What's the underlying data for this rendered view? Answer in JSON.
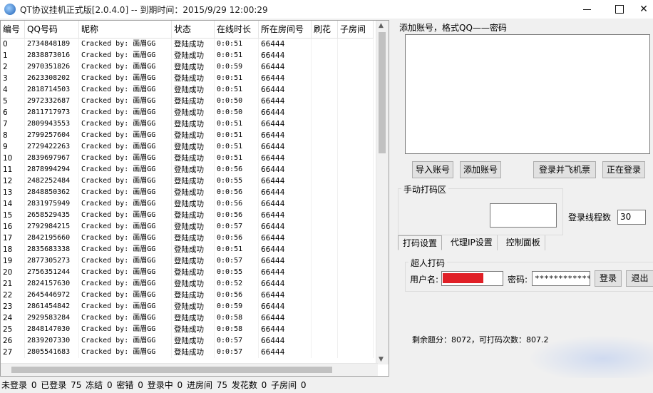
{
  "window": {
    "title": "QT协议挂机正式版[2.0.4.0] -- 到期时间：2015/9/29 12:00:29",
    "icon": "qq-globe-icon",
    "close_glyph": "✕"
  },
  "grid": {
    "columns": [
      "编号",
      "QQ号码",
      "昵称",
      "状态",
      "在线时长",
      "所在房间号",
      "刷花",
      "子房间"
    ],
    "rows": [
      [
        "0",
        "2734848189",
        "Cracked by: 画眉GG",
        "登陆成功",
        "0:0:51",
        "66444"
      ],
      [
        "1",
        "2838873016",
        "Cracked by: 画眉GG",
        "登陆成功",
        "0:0:51",
        "66444"
      ],
      [
        "2",
        "2970351826",
        "Cracked by: 画眉GG",
        "登陆成功",
        "0:0:59",
        "66444"
      ],
      [
        "3",
        "2623308202",
        "Cracked by: 画眉GG",
        "登陆成功",
        "0:0:51",
        "66444"
      ],
      [
        "4",
        "2818714503",
        "Cracked by: 画眉GG",
        "登陆成功",
        "0:0:51",
        "66444"
      ],
      [
        "5",
        "2972332687",
        "Cracked by: 画眉GG",
        "登陆成功",
        "0:0:50",
        "66444"
      ],
      [
        "6",
        "2811717973",
        "Cracked by: 画眉GG",
        "登陆成功",
        "0:0:50",
        "66444"
      ],
      [
        "7",
        "2809943553",
        "Cracked by: 画眉GG",
        "登陆成功",
        "0:0:51",
        "66444"
      ],
      [
        "8",
        "2799257604",
        "Cracked by: 画眉GG",
        "登陆成功",
        "0:0:51",
        "66444"
      ],
      [
        "9",
        "2729422263",
        "Cracked by: 画眉GG",
        "登陆成功",
        "0:0:51",
        "66444"
      ],
      [
        "10",
        "2839697967",
        "Cracked by: 画眉GG",
        "登陆成功",
        "0:0:51",
        "66444"
      ],
      [
        "11",
        "2878994294",
        "Cracked by: 画眉GG",
        "登陆成功",
        "0:0:56",
        "66444"
      ],
      [
        "12",
        "2482252484",
        "Cracked by: 画眉GG",
        "登陆成功",
        "0:0:55",
        "66444"
      ],
      [
        "13",
        "2848850362",
        "Cracked by: 画眉GG",
        "登陆成功",
        "0:0:56",
        "66444"
      ],
      [
        "14",
        "2831975949",
        "Cracked by: 画眉GG",
        "登陆成功",
        "0:0:56",
        "66444"
      ],
      [
        "15",
        "2658529435",
        "Cracked by: 画眉GG",
        "登陆成功",
        "0:0:56",
        "66444"
      ],
      [
        "16",
        "2792984215",
        "Cracked by: 画眉GG",
        "登陆成功",
        "0:0:57",
        "66444"
      ],
      [
        "17",
        "2842195660",
        "Cracked by: 画眉GG",
        "登陆成功",
        "0:0:56",
        "66444"
      ],
      [
        "18",
        "2835683338",
        "Cracked by: 画眉GG",
        "登陆成功",
        "0:0:51",
        "66444"
      ],
      [
        "19",
        "2877305273",
        "Cracked by: 画眉GG",
        "登陆成功",
        "0:0:57",
        "66444"
      ],
      [
        "20",
        "2756351244",
        "Cracked by: 画眉GG",
        "登陆成功",
        "0:0:55",
        "66444"
      ],
      [
        "21",
        "2824157630",
        "Cracked by: 画眉GG",
        "登陆成功",
        "0:0:52",
        "66444"
      ],
      [
        "22",
        "2645446972",
        "Cracked by: 画眉GG",
        "登陆成功",
        "0:0:56",
        "66444"
      ],
      [
        "23",
        "2861454842",
        "Cracked by: 画眉GG",
        "登陆成功",
        "0:0:59",
        "66444"
      ],
      [
        "24",
        "2929583284",
        "Cracked by: 画眉GG",
        "登陆成功",
        "0:0:58",
        "66444"
      ],
      [
        "25",
        "2848147030",
        "Cracked by: 画眉GG",
        "登陆成功",
        "0:0:58",
        "66444"
      ],
      [
        "26",
        "2839207330",
        "Cracked by: 画眉GG",
        "登陆成功",
        "0:0:57",
        "66444"
      ],
      [
        "27",
        "2805541683",
        "Cracked by: 画眉GG",
        "登陆成功",
        "0:0:57",
        "66444"
      ]
    ]
  },
  "status_bar": "未登录 0 已登录 75 冻结 0 密错 0 登录中 0 进房间 75 发花数 0 子房间 0",
  "account_panel": {
    "label": "添加账号，格式QQ——密码",
    "import_button": "导入账号",
    "add_button": "添加账号",
    "login_fly_button": "登录并飞机票",
    "logging_in_button": "正在登录"
  },
  "captcha_group": {
    "title": "手动打码区",
    "threads_label": "登录线程数",
    "threads_value": "30"
  },
  "tabs": [
    "打码设置",
    "代理IP设置",
    "控制面板"
  ],
  "chaoren": {
    "title": "超人打码",
    "username_label": "用户名:",
    "password_label": "密码:",
    "password_value": "************",
    "login_button": "登录",
    "logout_button": "退出",
    "redacted_color": "#e01f26"
  },
  "balance_text": "剩余题分：8072，可打码次数：807.2"
}
